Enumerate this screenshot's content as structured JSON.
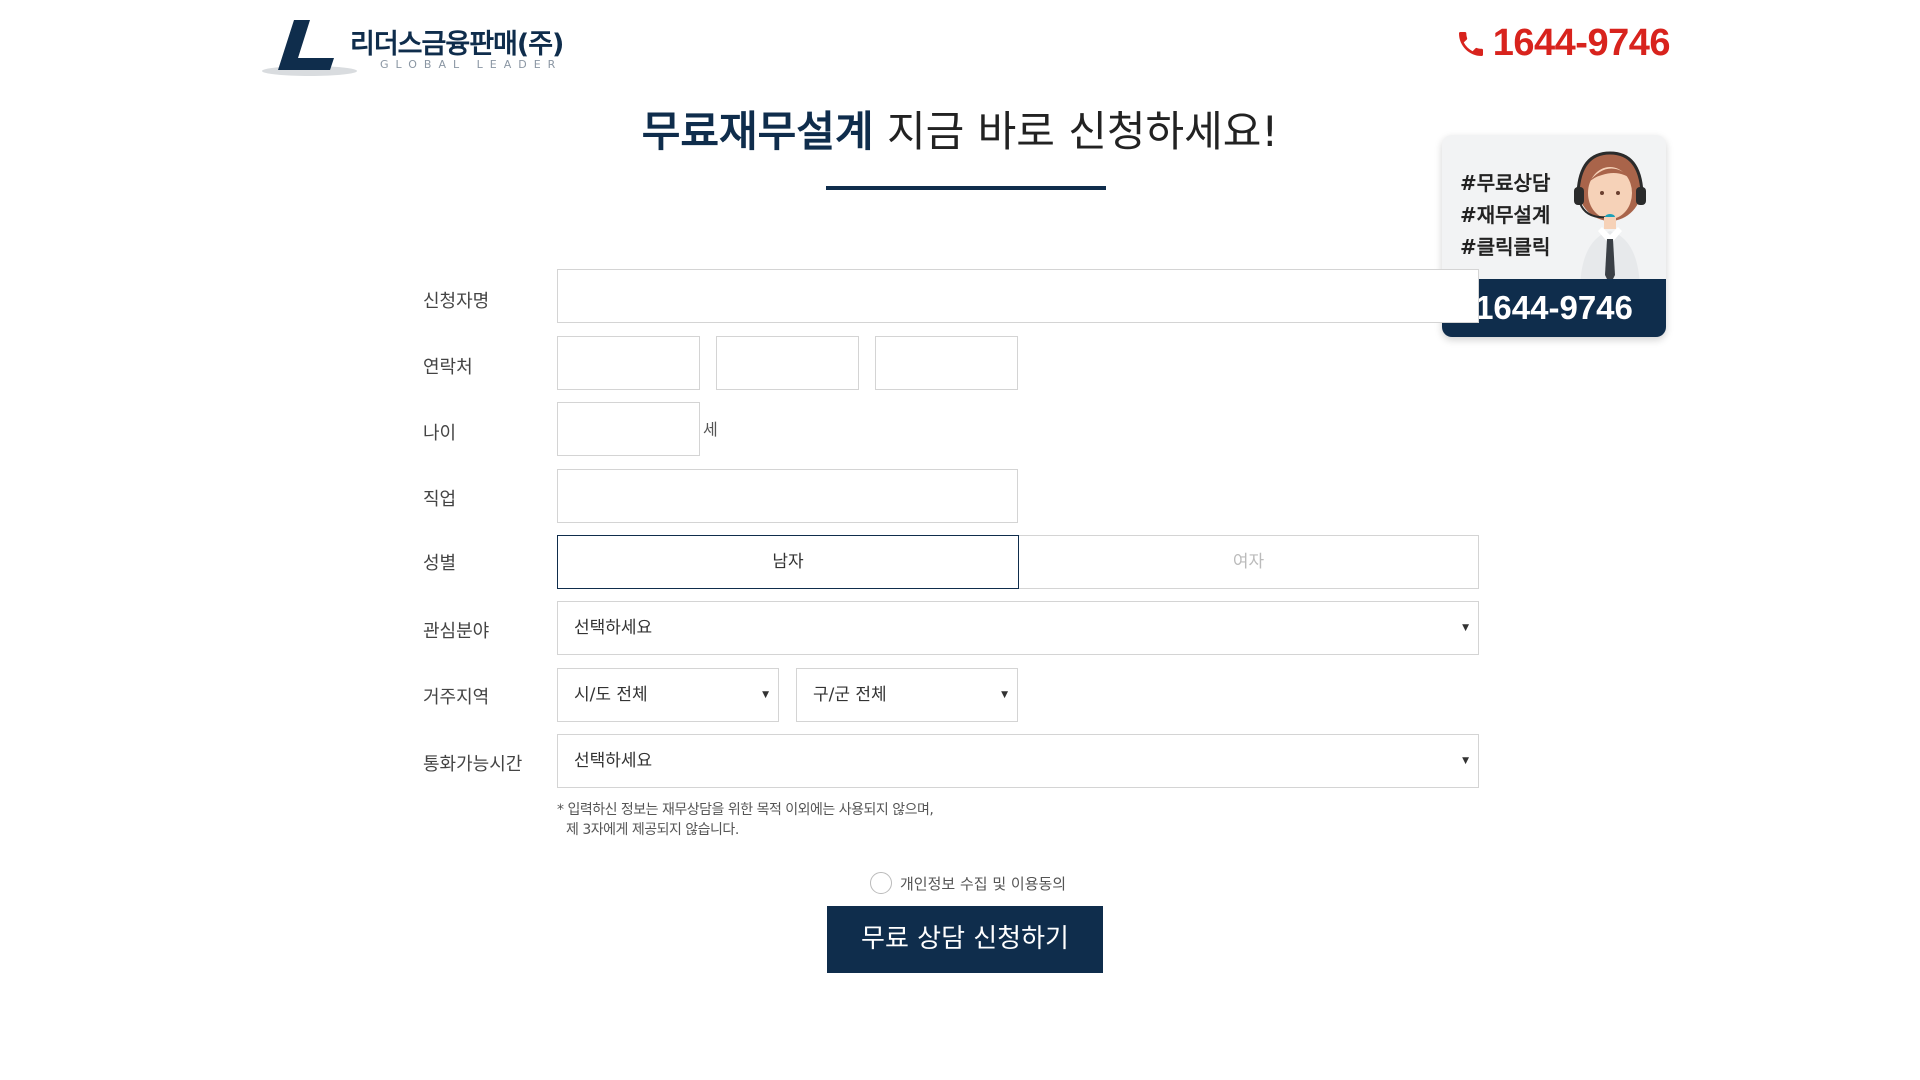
{
  "header": {
    "brand": "리더스금융판매(주)",
    "tagline": "GLOBAL LEADER",
    "phone": "1644-9746"
  },
  "title": {
    "strong": "무료재무설계",
    "rest": " 지금 바로 신청하세요!"
  },
  "call_card": {
    "tags": [
      "#무료상담",
      "#재무설계",
      "#클릭클릭"
    ],
    "phone": "1644-9746"
  },
  "form": {
    "name_label": "신청자명",
    "contact_label": "연락처",
    "age_label": "나이",
    "age_unit": "세",
    "job_label": "직업",
    "gender_label": "성별",
    "gender_male": "남자",
    "gender_female": "여자",
    "interest_label": "관심분야",
    "interest_value": "선택하세요",
    "region_label": "거주지역",
    "region_city": "시/도 전체",
    "region_district": "구/군 전체",
    "calltime_label": "통화가능시간",
    "calltime_value": "선택하세요",
    "notice_line1": "* 입력하신 정보는 재무상담을 위한 목적 이외에는 사용되지 않으며,",
    "notice_line2": "제 3자에게 제공되지 않습니다.",
    "agree_label": "개인정보 수집 및 이용동의",
    "submit_label": "무료 상담 신청하기"
  },
  "colors": {
    "navy": "#0f2d4c",
    "red": "#d8231d"
  }
}
